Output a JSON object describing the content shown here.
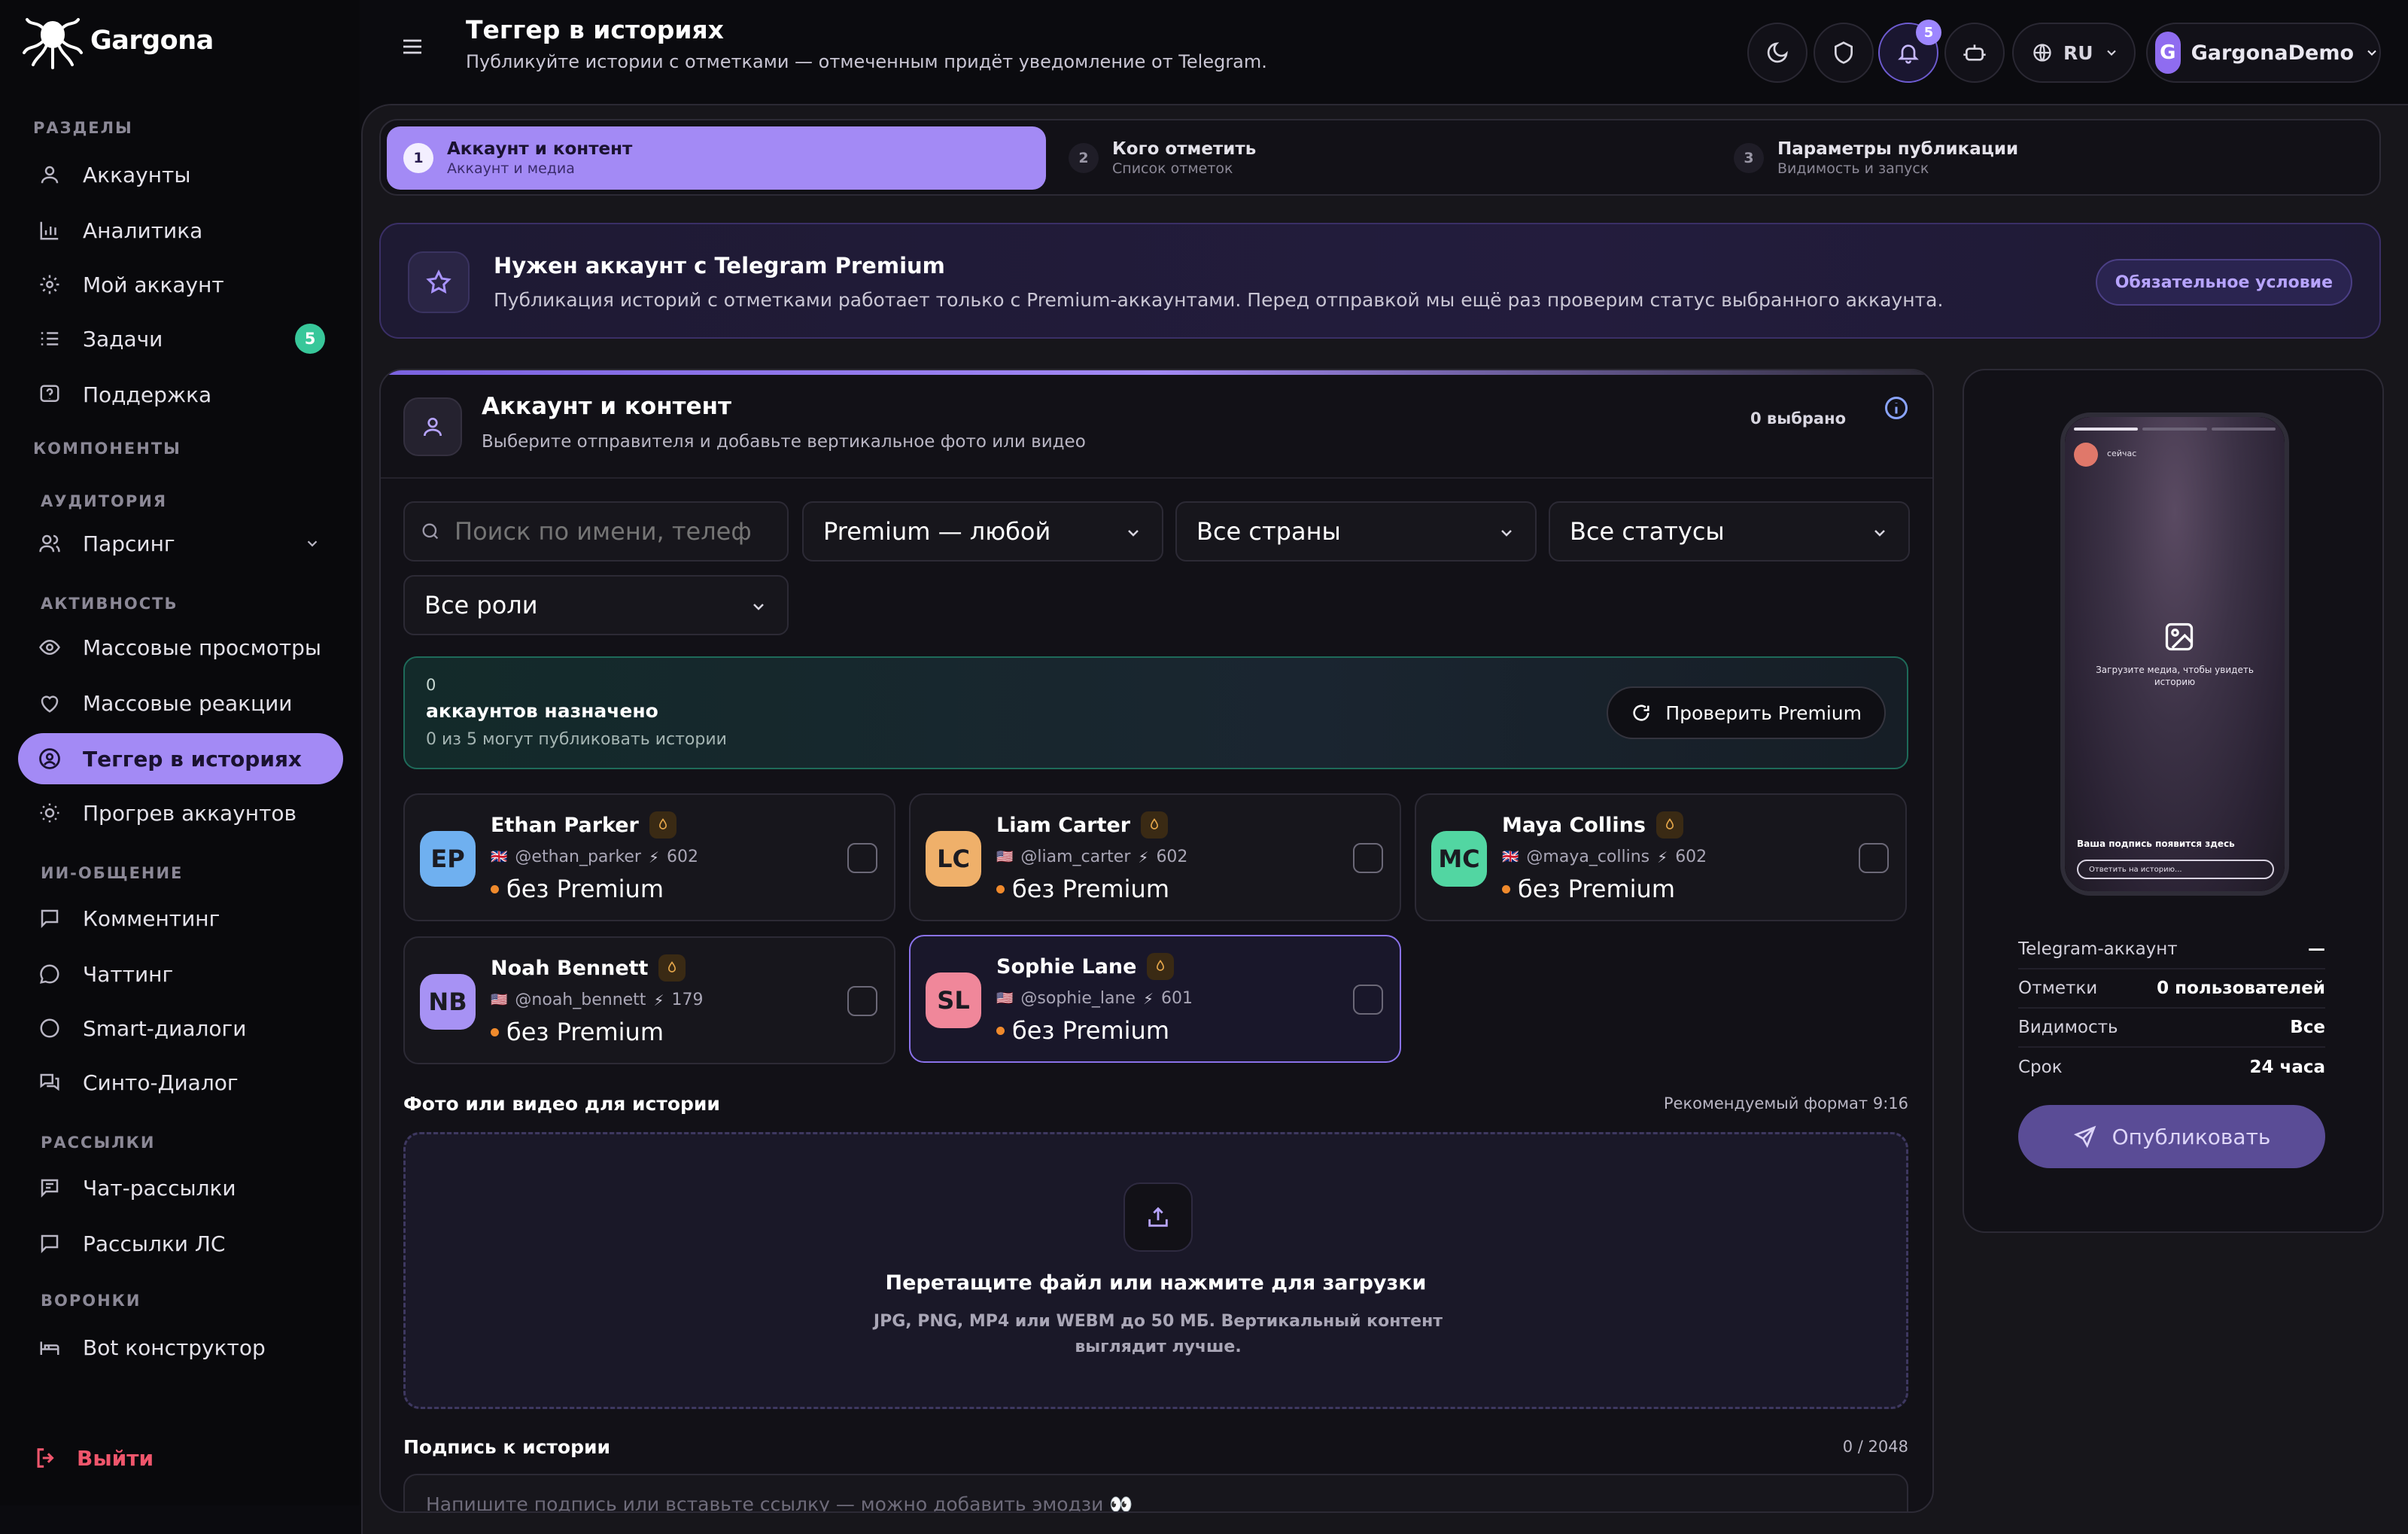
{
  "brand": {
    "name": "Gargona"
  },
  "sidebar": {
    "sections": {
      "razdely": "РАЗДЕЛЫ",
      "komponenty": "КОМПОНЕНТЫ",
      "auditoriya": "АУДИТОРИЯ",
      "aktivnost": "АКТИВНОСТЬ",
      "ii": "ИИ-ОБЩЕНИЕ",
      "rassylki": "РАССЫЛКИ",
      "voronki": "ВОРОНКИ"
    },
    "items": {
      "accounts": "Аккаунты",
      "analytics": "Аналитика",
      "my_account": "Мой аккаунт",
      "tasks": "Задачи",
      "tasks_badge": "5",
      "support": "Поддержка",
      "parsing": "Парсинг",
      "mass_views": "Массовые просмотры",
      "mass_reactions": "Массовые реакции",
      "story_tagger": "Теггер в историях",
      "warmup": "Прогрев аккаунтов",
      "commenting": "Комментинг",
      "chatting": "Чаттинг",
      "smart_dialogs": "Smart-диалоги",
      "synth_dialog": "Синто-Диалог",
      "chat_mailing": "Чат-рассылки",
      "dm_mailing": "Рассылки ЛС",
      "bot_builder": "Bot конструктор"
    },
    "logout": "Выйти"
  },
  "header": {
    "title": "Теггер в историях",
    "subtitle": "Публикуйте истории с отметками — отмеченным придёт уведомление от Telegram.",
    "notifications_count": "5",
    "language": "RU",
    "user_initial": "G",
    "user_name": "GargonaDemo"
  },
  "stepper": [
    {
      "num": "1",
      "title": "Аккаунт и контент",
      "sub": "Аккаунт и медиа"
    },
    {
      "num": "2",
      "title": "Кого отметить",
      "sub": "Список отметок"
    },
    {
      "num": "3",
      "title": "Параметры публикации",
      "sub": "Видимость и запуск"
    }
  ],
  "premium_banner": {
    "title": "Нужен аккаунт с Telegram Premium",
    "text": "Публикация историй с отметками работает только с Premium-аккаунтами. Перед отправкой мы ещё раз проверим статус выбранного аккаунта.",
    "tag": "Обязательное условие"
  },
  "content_card": {
    "title": "Аккаунт и контент",
    "subtitle": "Выберите отправителя и добавьте вертикальное фото или видео",
    "selected": "0 выбрано"
  },
  "filters": {
    "search_placeholder": "Поиск по имени, телефону или @username",
    "premium": "Premium — любой",
    "countries": "Все страны",
    "statuses": "Все статусы",
    "roles": "Все роли"
  },
  "assigned": {
    "count": "0",
    "title": "аккаунтов назначено",
    "sub": "0 из 5 могут публиковать истории",
    "check_button": "Проверить Premium"
  },
  "accounts": [
    {
      "initials": "EP",
      "name": "Ethan Parker",
      "flag": "🇬🇧",
      "username": "@ethan_parker",
      "score": "602",
      "status": "без Premium",
      "color": "#6fb0f0"
    },
    {
      "initials": "LC",
      "name": "Liam Carter",
      "flag": "🇺🇸",
      "username": "@liam_carter",
      "score": "602",
      "status": "без Premium",
      "color": "#efb06a"
    },
    {
      "initials": "MC",
      "name": "Maya Collins",
      "flag": "🇬🇧",
      "username": "@maya_collins",
      "score": "602",
      "status": "без Premium",
      "color": "#52d6a2"
    },
    {
      "initials": "NB",
      "name": "Noah Bennett",
      "flag": "🇺🇸",
      "username": "@noah_bennett",
      "score": "179",
      "status": "без Premium",
      "color": "#a792f4"
    },
    {
      "initials": "SL",
      "name": "Sophie Lane",
      "flag": "🇺🇸",
      "username": "@sophie_lane",
      "score": "601",
      "status": "без Premium",
      "color": "#f0879a"
    }
  ],
  "media": {
    "label": "Фото или видео для истории",
    "hint": "Рекомендуемый формат 9:16",
    "drop_title": "Перетащите файл или нажмите для загрузки",
    "drop_sub": "JPG, PNG, MP4 или WEBM до 50 МБ. Вертикальный контент выглядит лучше."
  },
  "caption": {
    "label": "Подпись к истории",
    "counter": "0 / 2048",
    "placeholder": "Напишите подпись или вставьте ссылку — можно добавить эмодзи 👀"
  },
  "preview": {
    "time": "сейчас",
    "upload_hint": "Загрузите медиа, чтобы увидеть историю",
    "caption_placeholder": "Ваша подпись появится здесь",
    "reply_placeholder": "Ответить на историю...",
    "rows": [
      {
        "k": "Telegram-аккаунт",
        "v": "—"
      },
      {
        "k": "Отметки",
        "v": "0 пользователей"
      },
      {
        "k": "Видимость",
        "v": "Все"
      },
      {
        "k": "Срок",
        "v": "24 часа"
      }
    ],
    "publish": "Опубликовать"
  }
}
